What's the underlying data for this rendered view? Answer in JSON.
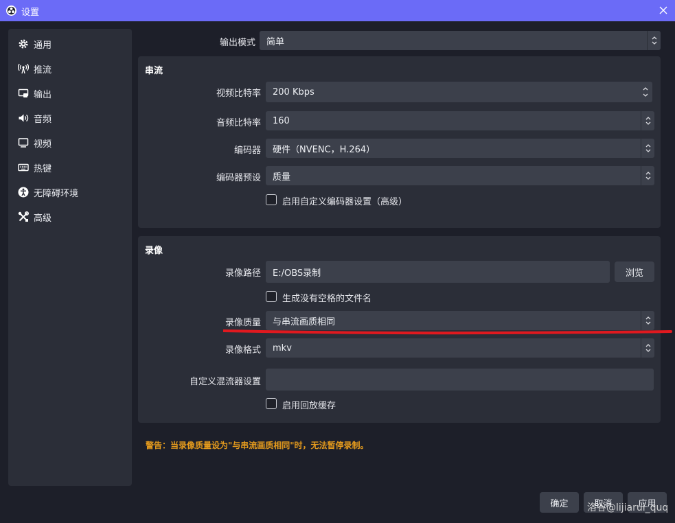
{
  "window": {
    "title": "设置"
  },
  "sidebar": {
    "items": [
      {
        "label": "通用",
        "icon": "gear-icon"
      },
      {
        "label": "推流",
        "icon": "antenna-icon"
      },
      {
        "label": "输出",
        "icon": "output-icon"
      },
      {
        "label": "音频",
        "icon": "speaker-icon"
      },
      {
        "label": "视频",
        "icon": "monitor-icon"
      },
      {
        "label": "热键",
        "icon": "keyboard-icon"
      },
      {
        "label": "无障碍环境",
        "icon": "accessibility-icon"
      },
      {
        "label": "高级",
        "icon": "tools-icon"
      }
    ]
  },
  "output_mode": {
    "label": "输出模式",
    "value": "简单"
  },
  "streaming": {
    "title": "串流",
    "video_bitrate": {
      "label": "视频比特率",
      "value": "200 Kbps"
    },
    "audio_bitrate": {
      "label": "音频比特率",
      "value": "160"
    },
    "encoder": {
      "label": "编码器",
      "value": "硬件（NVENC，H.264）"
    },
    "encoder_preset": {
      "label": "编码器预设",
      "value": "质量"
    },
    "custom_encoder_checkbox": {
      "label": "启用自定义编码器设置（高级）",
      "checked": false
    }
  },
  "recording": {
    "title": "录像",
    "path": {
      "label": "录像路径",
      "value": "E:/OBS录制",
      "browse_label": "浏览"
    },
    "no_space_filename": {
      "label": "生成没有空格的文件名",
      "checked": false
    },
    "quality": {
      "label": "录像质量",
      "value": "与串流画质相同"
    },
    "format": {
      "label": "录像格式",
      "value": "mkv"
    },
    "custom_muxer": {
      "label": "自定义混流器设置",
      "value": ""
    },
    "replay_buffer": {
      "label": "启用回放缓存",
      "checked": false
    }
  },
  "warning_text": "警告：当录像质量设为\"与串流画质相同\"时，无法暂停录制。",
  "buttons": {
    "ok": "确定",
    "cancel": "取消",
    "apply": "应用"
  },
  "watermark": "洛谷@lijiarui_quq",
  "colors": {
    "titlebar": "#6b6bf7",
    "background": "#1d1f29",
    "panel": "#2b2e38",
    "field": "#3c404b",
    "warning": "#e59b1d",
    "annotation_line": "#e0191f"
  }
}
